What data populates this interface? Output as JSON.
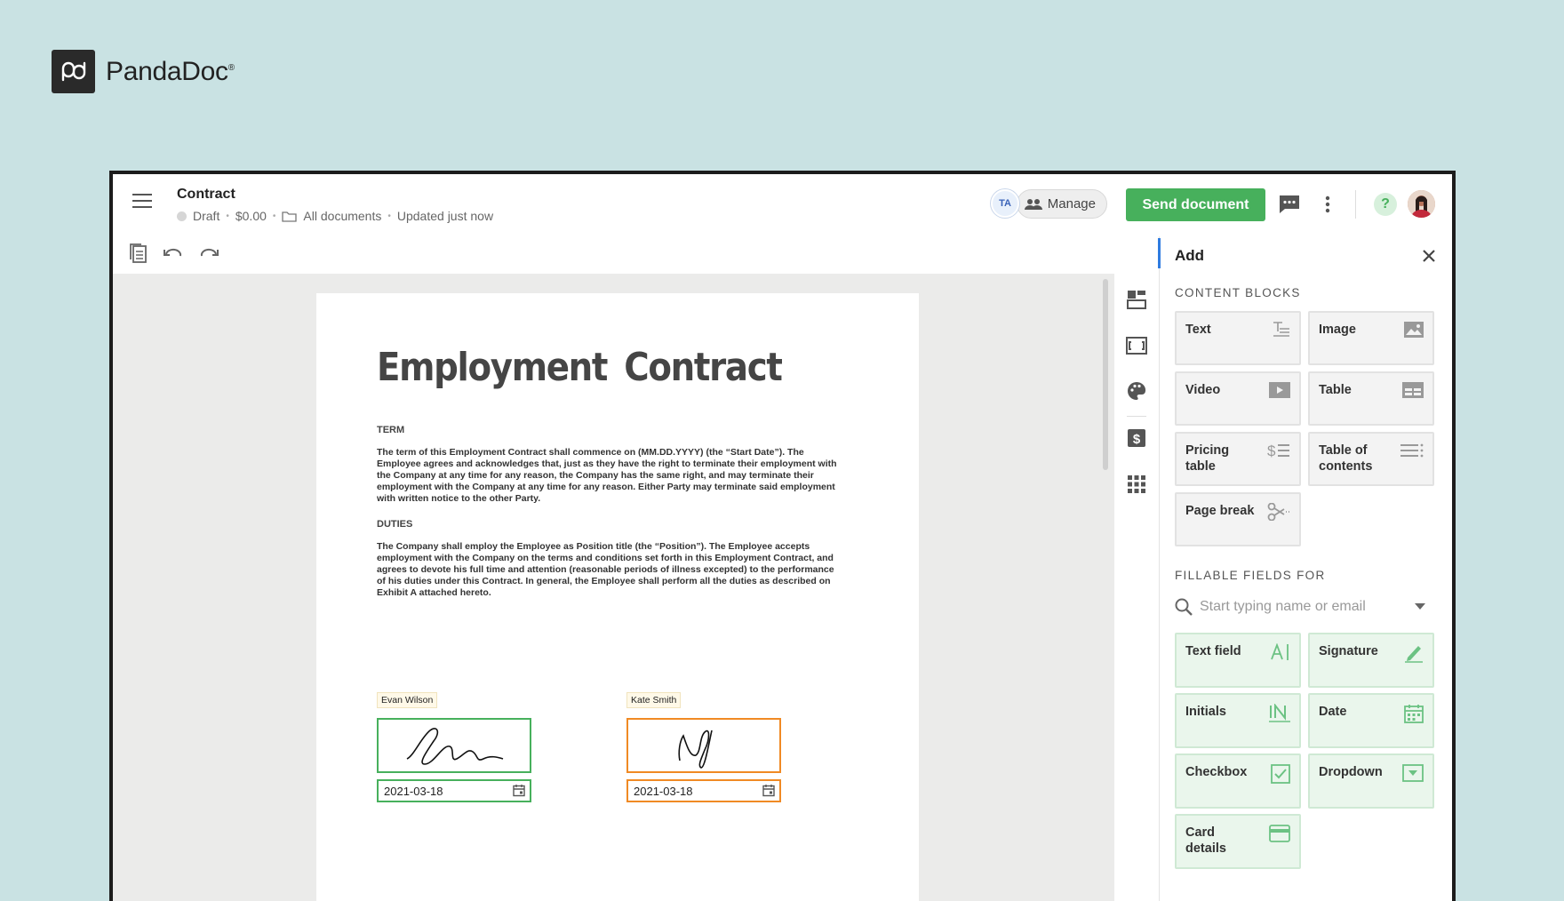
{
  "brand": {
    "name": "PandaDoc",
    "mark": "®"
  },
  "header": {
    "title": "Contract",
    "status": "Draft",
    "amount": "$0.00",
    "folder": "All documents",
    "updated": "Updated just now",
    "avatar_initials": "TA",
    "manage_label": "Manage",
    "send_label": "Send document",
    "help_label": "?"
  },
  "document": {
    "heading": "Employment Contract",
    "sections": [
      {
        "title": "TERM",
        "body": "The term of this Employment Contract shall commence on (MM.DD.YYYY) (the “Start Date”). The Employee agrees and acknowledges that, just as they have the right to terminate their employment with the Company at any time for any reason, the Company has the same right, and may terminate their employment with the Company at any time for any reason. Either Party may terminate said employment with written notice to the other Party."
      },
      {
        "title": "DUTIES",
        "body": "The Company shall employ the Employee as Position title (the “Position”). The Employee accepts employment with the Company on the terms and conditions set forth in this Employment Contract, and agrees to devote his full time and attention (reasonable periods of illness excepted) to the performance of his duties under this Contract. In general, the Employee shall perform all the duties as described on Exhibit A attached hereto."
      }
    ],
    "signers": [
      {
        "name": "Evan  Wilson",
        "date": "2021-03-18",
        "color": "#47b05c"
      },
      {
        "name": "Kate  Smith",
        "date": "2021-03-18",
        "color": "#f08a24"
      }
    ]
  },
  "panel": {
    "title": "Add",
    "content_blocks_label": "CONTENT BLOCKS",
    "content_blocks": [
      {
        "label": "Text",
        "icon": "text-icon"
      },
      {
        "label": "Image",
        "icon": "image-icon"
      },
      {
        "label": "Video",
        "icon": "video-icon"
      },
      {
        "label": "Table",
        "icon": "table-icon"
      },
      {
        "label": "Pricing table",
        "icon": "pricing-table-icon"
      },
      {
        "label": "Table of contents",
        "icon": "table-of-contents-icon"
      },
      {
        "label": "Page break",
        "icon": "scissors-icon"
      }
    ],
    "fillable_label": "FILLABLE FIELDS FOR",
    "search_placeholder": "Start typing name or email",
    "fields": [
      {
        "label": "Text field",
        "icon": "text-field-icon"
      },
      {
        "label": "Signature",
        "icon": "pen-icon"
      },
      {
        "label": "Initials",
        "icon": "initials-icon"
      },
      {
        "label": "Date",
        "icon": "calendar-icon"
      },
      {
        "label": "Checkbox",
        "icon": "checkbox-icon"
      },
      {
        "label": "Dropdown",
        "icon": "dropdown-icon"
      },
      {
        "label": "Card details",
        "icon": "card-icon"
      }
    ]
  },
  "colors": {
    "accent_green": "#47b05c",
    "signer_orange": "#f08a24",
    "panel_accent": "#2f7be0",
    "background": "#c9e2e3"
  }
}
